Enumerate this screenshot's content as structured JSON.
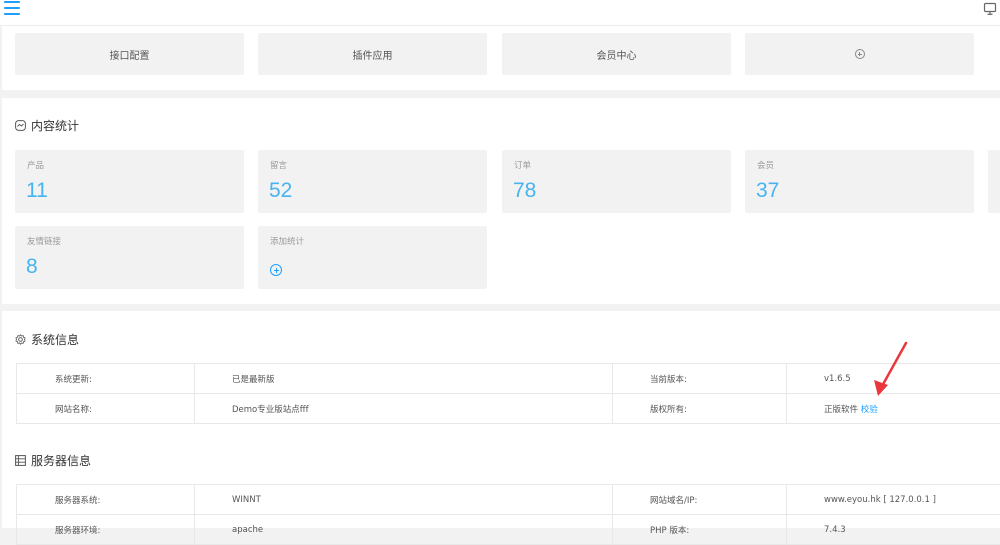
{
  "quick_links": [
    {
      "label": "接口配置"
    },
    {
      "label": "插件应用"
    },
    {
      "label": "会员中心"
    }
  ],
  "content_stats": {
    "title": "内容统计",
    "cards": [
      {
        "label": "产品",
        "value": "11"
      },
      {
        "label": "留言",
        "value": "52"
      },
      {
        "label": "订单",
        "value": "78"
      },
      {
        "label": "会员",
        "value": "37"
      },
      {
        "label": "友情链接",
        "value": "8"
      },
      {
        "label": "添加统计"
      }
    ]
  },
  "system_info": {
    "title": "系统信息",
    "rows": [
      {
        "k1": "系统更新:",
        "v1": "已是最新版",
        "k2": "当前版本:",
        "v2": "v1.6.5"
      },
      {
        "k1": "网站名称:",
        "v1": "Demo专业版站点fff",
        "k2": "版权所有:",
        "v2": "正版软件",
        "v2_link": "校验"
      }
    ]
  },
  "server_info": {
    "title": "服务器信息",
    "rows": [
      {
        "k1": "服务器系统:",
        "v1": "WINNT",
        "k2": "网站域名/IP:",
        "v2": "www.eyou.hk [ 127.0.0.1 ]"
      },
      {
        "k1": "服务器环境:",
        "v1": "apache",
        "k2": "PHP 版本:",
        "v2": "7.4.3"
      }
    ]
  },
  "colors": {
    "accent": "#1e9fff",
    "stat_value": "#46b4f0",
    "arrow": "#e8383d"
  }
}
